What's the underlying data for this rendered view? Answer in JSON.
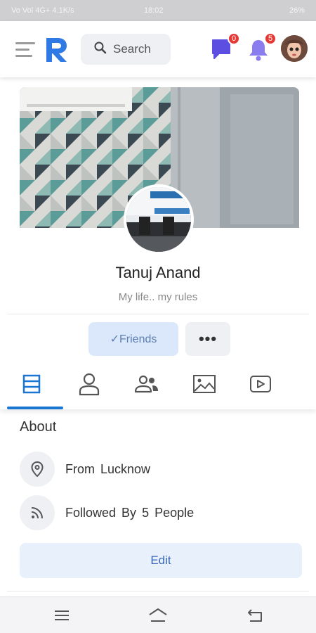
{
  "status_bar": {
    "left": "Vo Vol 4G+  4.1K/s",
    "time": "18:02",
    "right": "26%"
  },
  "header": {
    "logo_letter": "R",
    "search": {
      "placeholder": "Search"
    },
    "messages_badge": "0",
    "notifications_badge": "5"
  },
  "profile": {
    "name": "Tanuj Anand",
    "bio": "My life.. my rules",
    "friends_label": "✓Friends",
    "more_label": "•••"
  },
  "tabs": [
    {
      "icon": "timeline-icon",
      "active": true
    },
    {
      "icon": "person-icon",
      "active": false
    },
    {
      "icon": "friends-icon",
      "active": false
    },
    {
      "icon": "photos-icon",
      "active": false
    },
    {
      "icon": "videos-icon",
      "active": false
    }
  ],
  "about": {
    "title": "About",
    "from_label": "From",
    "from_value": "Lucknow",
    "followed_label": "Followed By",
    "followed_count": "5",
    "followed_suffix": "People",
    "edit_label": "Edit"
  },
  "colors": {
    "accent": "#1976d2",
    "badge": "#e53935",
    "friends_bg": "#dbe8fb",
    "messenger": "#5b4ee0",
    "bell": "#8b7cf0"
  }
}
